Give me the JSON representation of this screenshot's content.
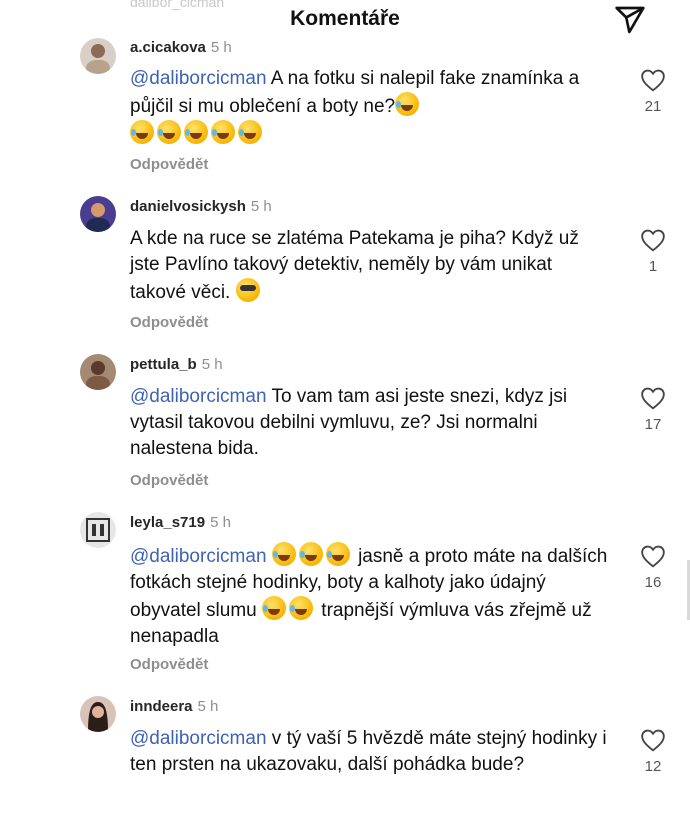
{
  "header": {
    "title": "Komentáře",
    "ghost_user": "dalibor_cicman",
    "send_icon": "paper-plane-icon"
  },
  "reply_label": "Odpovědět",
  "comments": [
    {
      "username": "a.cicakova",
      "time": "5 h",
      "mention": "@daliborcicman",
      "text": " A na fotku si nalepil fake znamínka a půjčil si mu oblečení a boty ne?",
      "likes": "21",
      "avatar_color": "#b9a28c"
    },
    {
      "username": "danielvosickysh",
      "time": "5 h",
      "mention": "",
      "text": "A kde na ruce se zlatéma Patekama je piha? Když už jste Pavlíno takový detektiv, neměly by vám unikat takové věci.",
      "likes": "1",
      "avatar_color": "#2b3a6e"
    },
    {
      "username": "pettula_b",
      "time": "5 h",
      "mention": "@daliborcicman",
      "text": "  To vam tam asi jeste snezi, kdyz jsi vytasil takovou debilni vymluvu, ze? Jsi normalni nalestena bida.",
      "likes": "17",
      "avatar_color": "#7c5a45"
    },
    {
      "username": "leyla_s719",
      "time": "5 h",
      "mention": "@daliborcicman",
      "text": "jasně a proto máte na dalších fotkách stejné hodinky, boty a kalhoty jako údajný obyvatel slumu",
      "text_after": "trapnější výmluva vás zřejmě už nenapadla",
      "likes": "16",
      "avatar_color": "#555555"
    },
    {
      "username": "inndeera",
      "time": "5 h",
      "mention": "@daliborcicman",
      "text": " v tý vaší 5 hvězdě máte stejný hodinky i ten prsten na ukazovaku, další pohádka bude?",
      "likes": "12",
      "avatar_color": "#3a2a26"
    }
  ]
}
